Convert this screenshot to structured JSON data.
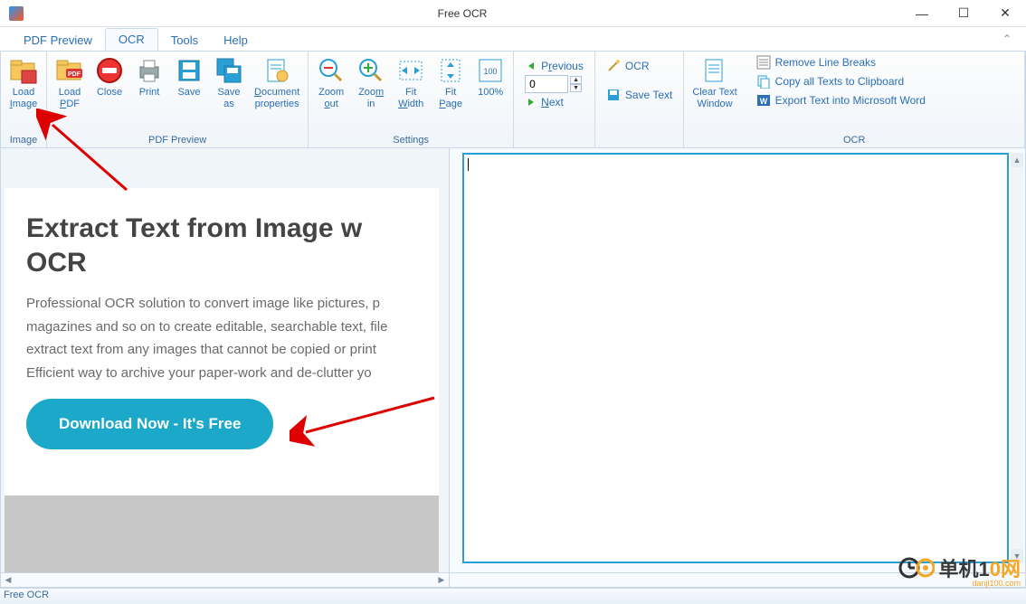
{
  "window": {
    "title": "Free OCR"
  },
  "menu": {
    "tabs": [
      "PDF Preview",
      "OCR",
      "Tools",
      "Help"
    ],
    "active": 1
  },
  "ribbon": {
    "image": {
      "label": "Image",
      "load_image": "Load Image"
    },
    "pdfpreview": {
      "label": "PDF Preview",
      "load_pdf": "Load PDF",
      "close": "Close",
      "print": "Print",
      "save": "Save",
      "save_as": "Save as",
      "doc_props": "Document properties"
    },
    "settings": {
      "label": "Settings",
      "zoom_out": "Zoom out",
      "zoom_in": "Zoom in",
      "fit_width": "Fit Width",
      "fit_page": "Fit Page",
      "p100": "100%"
    },
    "nav": {
      "previous": "Previous",
      "next": "Next",
      "page": "0"
    },
    "ocr_small": {
      "ocr": "OCR",
      "save_text": "Save Text"
    },
    "ocr": {
      "label": "OCR",
      "clear": "Clear Text Window",
      "remove_breaks": "Remove Line Breaks",
      "copy_all": "Copy all Texts to Clipboard",
      "export_word": "Export Text into Microsoft Word"
    }
  },
  "preview": {
    "heading_l1": "Extract Text from Image w",
    "heading_l2": "OCR",
    "para": "Professional OCR solution to convert image like pictures, p\nmagazines and so on to create editable, searchable text, file\nextract text from any images that cannot be copied or print\nEfficient way to archive your paper-work and de-clutter yo",
    "download": "Download Now - It's Free"
  },
  "status": {
    "text": "Free OCR"
  },
  "watermark": {
    "text1": "单机1",
    "text2": "0网",
    "sub": "danji100.com"
  }
}
